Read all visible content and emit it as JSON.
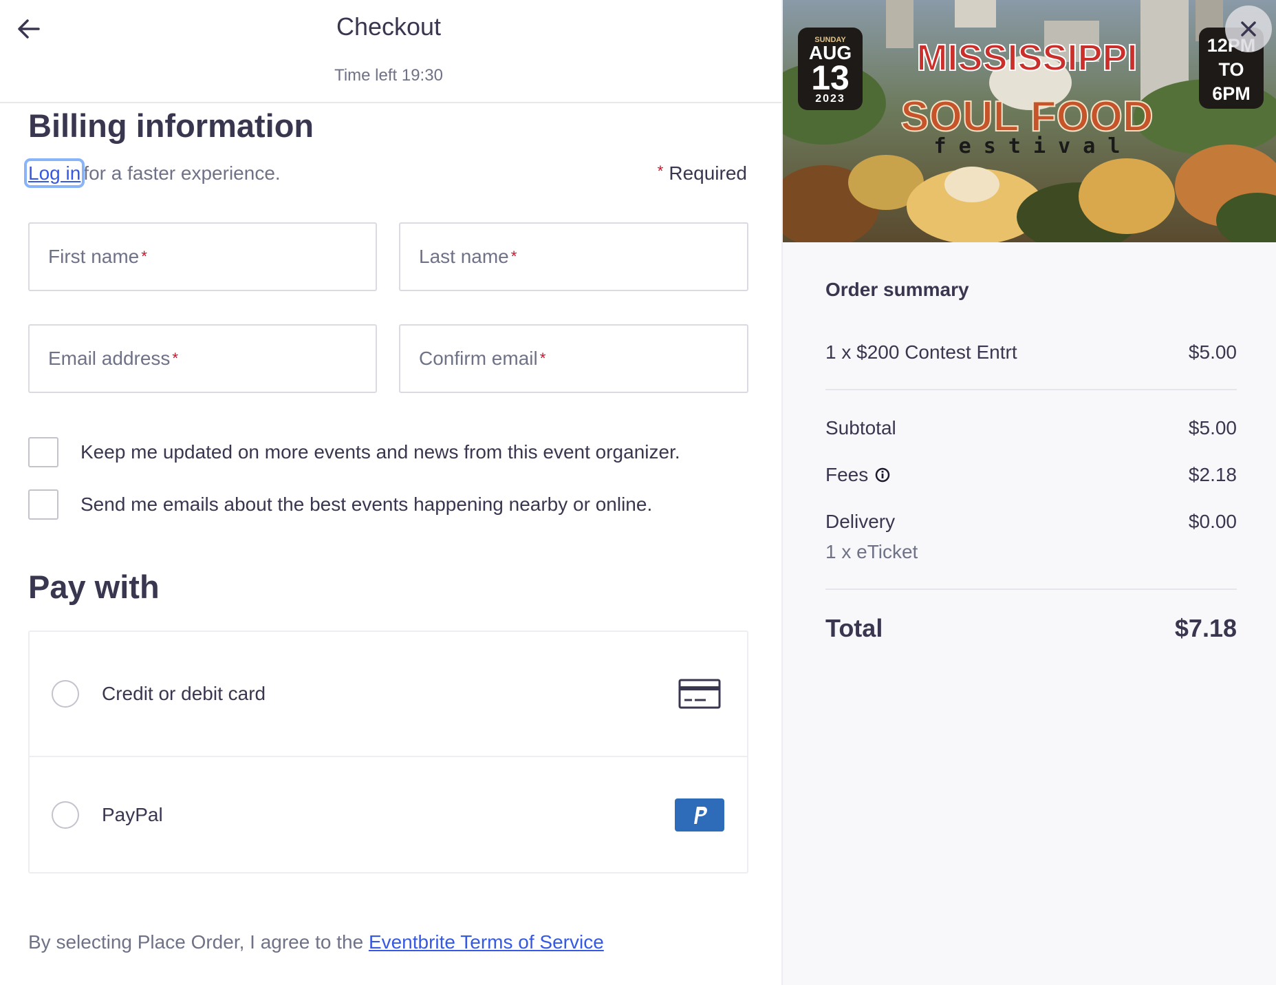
{
  "header": {
    "title": "Checkout",
    "timer": "Time left 19:30"
  },
  "billing": {
    "heading": "Billing information",
    "login_link": "Log in",
    "login_suffix": "for a faster experience.",
    "required_label": "Required",
    "fields": {
      "first_name": "First name",
      "last_name": "Last name",
      "email": "Email address",
      "confirm_email": "Confirm email"
    },
    "checkboxes": [
      "Keep me updated on more events and news from this event organizer.",
      "Send me emails about the best events happening nearby or online."
    ]
  },
  "payment": {
    "heading": "Pay with",
    "options": [
      {
        "label": "Credit or debit card",
        "icon": "credit-card-icon"
      },
      {
        "label": "PayPal",
        "icon": "paypal-icon"
      }
    ]
  },
  "terms": {
    "prefix": "By selecting Place Order, I agree to the",
    "link": "Eventbrite Terms of Service"
  },
  "event_banner": {
    "day": "SUNDAY",
    "month": "AUG",
    "date": "13",
    "year": "2023",
    "title_line1": "MISSISSIPPI",
    "title_line2": "SOUL FOOD",
    "title_line3": "f e s t i v a l",
    "time_line1": "12PM",
    "time_line2": "TO",
    "time_line3": "6PM"
  },
  "order_summary": {
    "title": "Order summary",
    "item_label": "1 x $200 Contest Entrt",
    "item_price": "$5.00",
    "subtotal_label": "Subtotal",
    "subtotal_value": "$5.00",
    "fees_label": "Fees",
    "fees_value": "$2.18",
    "delivery_label": "Delivery",
    "delivery_value": "$0.00",
    "delivery_detail": "1 x eTicket",
    "total_label": "Total",
    "total_value": "$7.18"
  },
  "colors": {
    "text": "#39364f",
    "muted": "#6f7287",
    "link": "#3659e3",
    "required_star": "#c5162e",
    "paypal": "#2e6bb8",
    "summary_bg": "#f8f7fa"
  }
}
